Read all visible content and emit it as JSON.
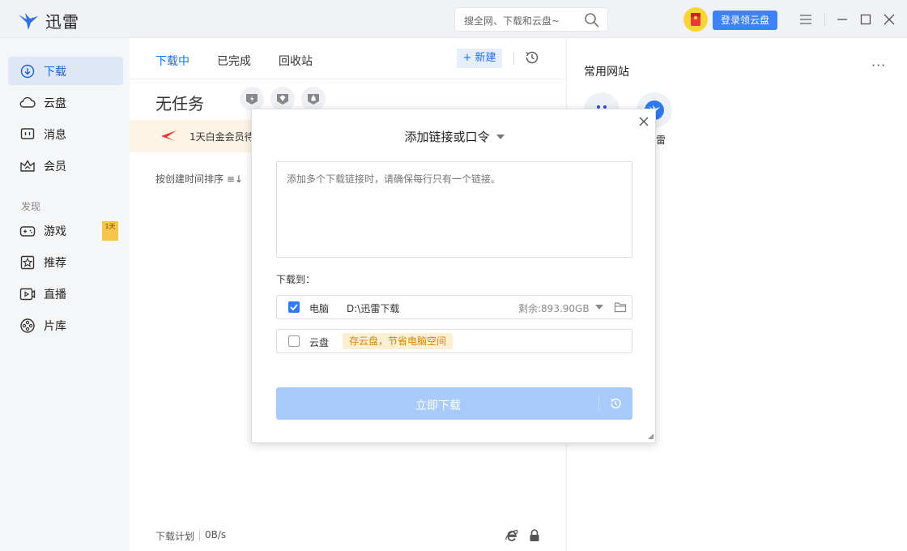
{
  "app": {
    "name": "迅雷"
  },
  "search": {
    "placeholder": "搜全网、下载和云盘~"
  },
  "header": {
    "login_label": "登录领云盘"
  },
  "sidebar": {
    "items": [
      {
        "label": "下载",
        "icon": "download-icon",
        "active": true
      },
      {
        "label": "云盘",
        "icon": "cloud-icon"
      },
      {
        "label": "消息",
        "icon": "message-icon"
      },
      {
        "label": "会员",
        "icon": "crown-icon"
      }
    ],
    "section_label": "发现",
    "discover_items": [
      {
        "label": "游戏",
        "icon": "gamepad-icon"
      },
      {
        "label": "推荐",
        "icon": "star-icon"
      },
      {
        "label": "直播",
        "icon": "live-icon"
      },
      {
        "label": "片库",
        "icon": "film-icon"
      }
    ],
    "game_badge": "1天"
  },
  "tasks": {
    "tabs": [
      "下载中",
      "已完成",
      "回收站"
    ],
    "new_label": "+ 新建",
    "empty_label": "无任务",
    "promo_text": "1天白金会员待",
    "sort_label": "按创建时间排序 ≡↓"
  },
  "footer": {
    "plan_label": "下载计划",
    "speed": "0B/s"
  },
  "right_panel": {
    "title": "常用网站",
    "more": "···",
    "site_label": "雷"
  },
  "modal": {
    "title": "添加链接或口令",
    "textarea_placeholder": "添加多个下载链接时，请确保每行只有一个链接。",
    "download_to": "下载到：",
    "pc_label": "电脑",
    "pc_path": "D:\\迅雷下载",
    "pc_space": "剩余:893.90GB",
    "cloud_label": "云盘",
    "cloud_tip": "存云盘，节省电脑空间",
    "download_button": "立即下载"
  },
  "colors": {
    "accent": "#1d6ff2",
    "button_disabled": "#a9cbfb",
    "promo_bg": "#fdf4e5"
  }
}
